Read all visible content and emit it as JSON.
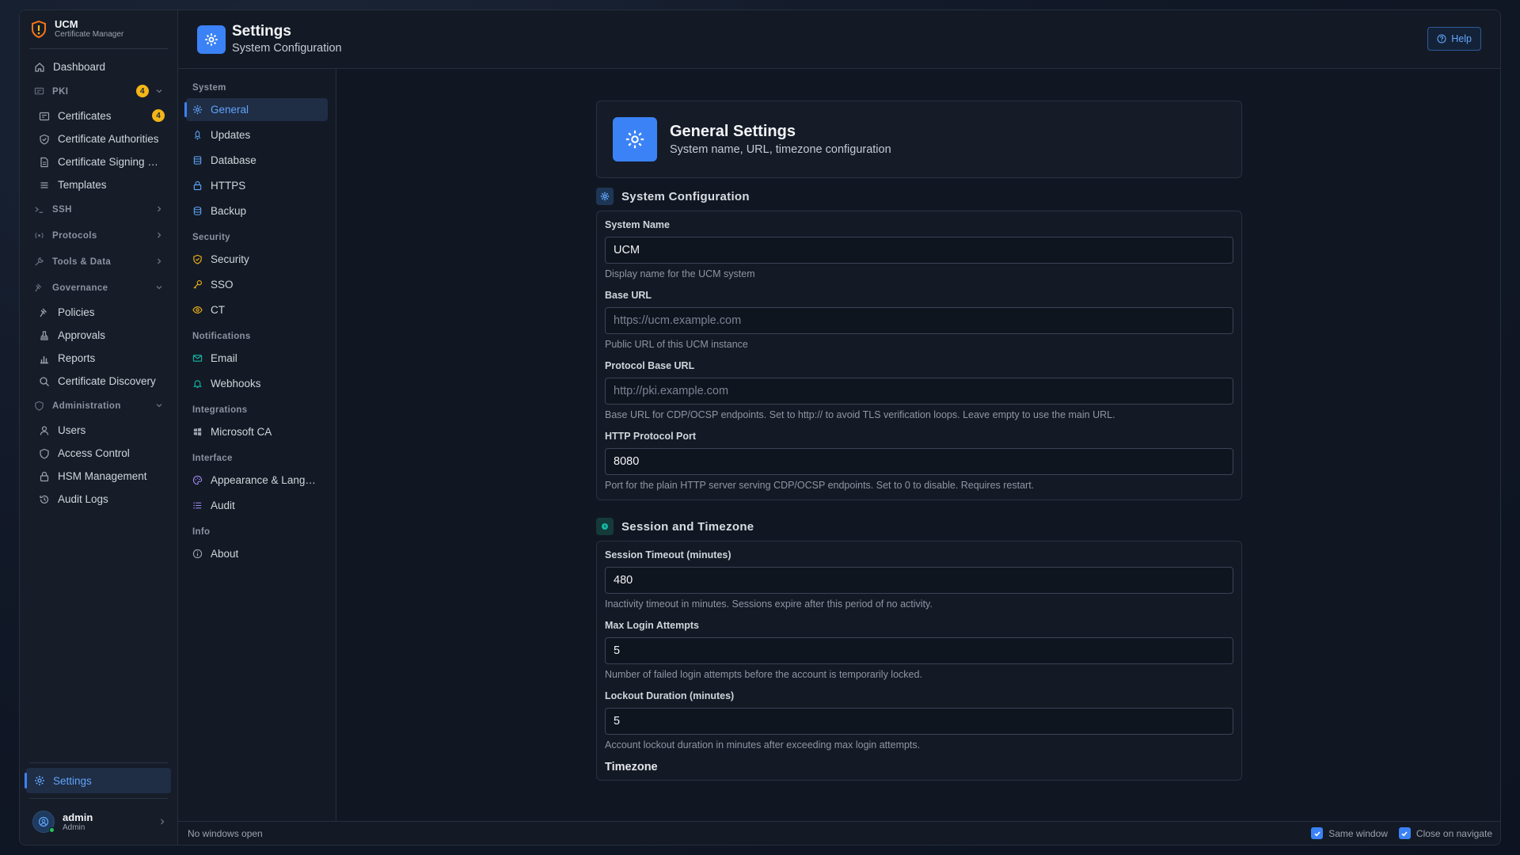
{
  "brand": {
    "title": "UCM",
    "subtitle": "Certificate Manager"
  },
  "sidebar": {
    "dashboard": "Dashboard",
    "pki": {
      "label": "PKI",
      "badge": "4"
    },
    "pki_items": {
      "certificates": {
        "label": "Certificates",
        "badge": "4"
      },
      "cas": "Certificate Authorities",
      "csr": "Certificate Signing Requests",
      "templates": "Templates"
    },
    "ssh": "SSH",
    "protocols": "Protocols",
    "tools": "Tools & Data",
    "governance": "Governance",
    "gov_items": {
      "policies": "Policies",
      "approvals": "Approvals",
      "reports": "Reports",
      "discovery": "Certificate Discovery"
    },
    "administration": "Administration",
    "admin_items": {
      "users": "Users",
      "access": "Access Control",
      "hsm": "HSM Management",
      "audit": "Audit Logs"
    },
    "settings": "Settings",
    "user": {
      "name": "admin",
      "role": "Admin"
    }
  },
  "header": {
    "title": "Settings",
    "subtitle": "System Configuration",
    "help": "Help"
  },
  "settings_nav": {
    "system": "System",
    "general": "General",
    "updates": "Updates",
    "database": "Database",
    "https": "HTTPS",
    "backup": "Backup",
    "security_section": "Security",
    "security": "Security",
    "sso": "SSO",
    "ct": "CT",
    "notifications": "Notifications",
    "email": "Email",
    "webhooks": "Webhooks",
    "integrations": "Integrations",
    "microsoft_ca": "Microsoft CA",
    "interface": "Interface",
    "appearance": "Appearance & Language",
    "audit": "Audit",
    "info": "Info",
    "about": "About"
  },
  "general": {
    "title": "General Settings",
    "subtitle": "System name, URL, timezone configuration",
    "system_config": {
      "title": "System Configuration",
      "system_name": {
        "label": "System Name",
        "value": "UCM",
        "help": "Display name for the UCM system"
      },
      "base_url": {
        "label": "Base URL",
        "placeholder": "https://ucm.example.com",
        "help": "Public URL of this UCM instance"
      },
      "protocol_base_url": {
        "label": "Protocol Base URL",
        "placeholder": "http://pki.example.com",
        "help": "Base URL for CDP/OCSP endpoints. Set to http:// to avoid TLS verification loops. Leave empty to use the main URL."
      },
      "http_port": {
        "label": "HTTP Protocol Port",
        "value": "8080",
        "help": "Port for the plain HTTP server serving CDP/OCSP endpoints. Set to 0 to disable. Requires restart."
      }
    },
    "session": {
      "title": "Session and Timezone",
      "timeout": {
        "label": "Session Timeout (minutes)",
        "value": "480",
        "help": "Inactivity timeout in minutes. Sessions expire after this period of no activity."
      },
      "max_attempts": {
        "label": "Max Login Attempts",
        "value": "5",
        "help": "Number of failed login attempts before the account is temporarily locked."
      },
      "lockout": {
        "label": "Lockout Duration (minutes)",
        "value": "5",
        "help": "Account lockout duration in minutes after exceeding max login attempts."
      },
      "timezone_label": "Timezone"
    }
  },
  "statusbar": {
    "left": "No windows open",
    "same_window": "Same window",
    "close_on_navigate": "Close on navigate"
  },
  "colors": {
    "accent": "#3b82f6",
    "badge": "#f5b518",
    "session_icon": "#14b8a6"
  }
}
